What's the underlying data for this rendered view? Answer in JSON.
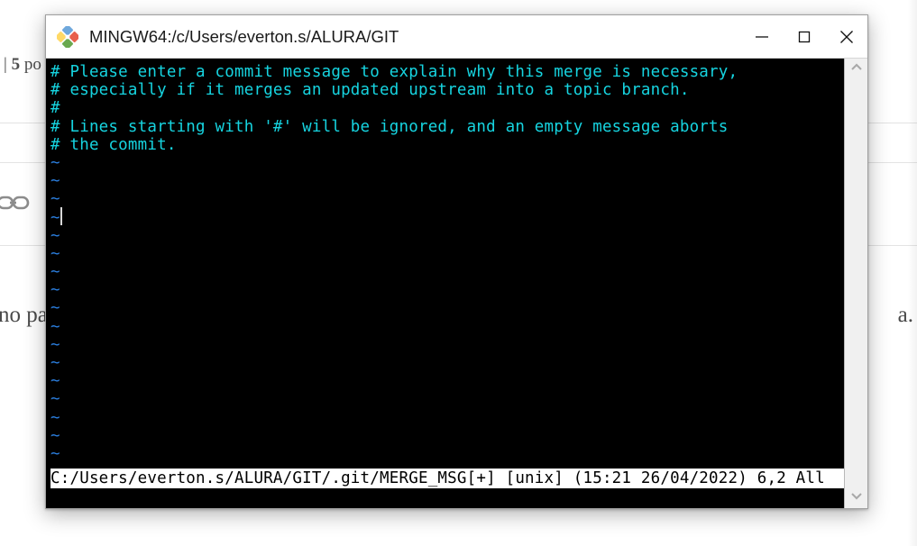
{
  "background_page": {
    "count_prefix": "| ",
    "count_value": "5",
    "count_suffix": " po",
    "link_icon": "chain-link-icon",
    "paragraph_left": "no pa",
    "paragraph_right": "a."
  },
  "window": {
    "title": "MINGW64:/c/Users/everton.s/ALURA/GIT",
    "icon": "mingw-git-bash-icon",
    "controls": {
      "minimize": "minimize-icon",
      "maximize": "maximize-icon",
      "close": "close-icon"
    }
  },
  "terminal": {
    "editor": "vim",
    "foreground_color": "#16d4e0",
    "tilde_color": "#2b7fe0",
    "background_color": "#000000",
    "lines": [
      "# Please enter a commit message to explain why this merge is necessary,",
      "# especially if it merges an updated upstream into a topic branch.",
      "#",
      "# Lines starting with '#' will be ignored, and an empty message aborts",
      "# the commit."
    ],
    "empty_line_marker": "~",
    "empty_line_count": 18,
    "status_line": {
      "file_path": "C:/Users/everton.s/ALURA/GIT/.git/MERGE_MSG",
      "modified_flag": "[+]",
      "file_format": "[unix]",
      "timestamp": "(15:21 26/04/2022)",
      "cursor_position": "6,2",
      "scroll_position": "All",
      "text": "C:/Users/everton.s/ALURA/GIT/.git/MERGE_MSG[+] [unix] (15:21 26/04/2022) 6,2 All"
    }
  },
  "scrollbar": {
    "up_arrow": "chevron-up-icon",
    "down_arrow": "chevron-down-icon"
  }
}
